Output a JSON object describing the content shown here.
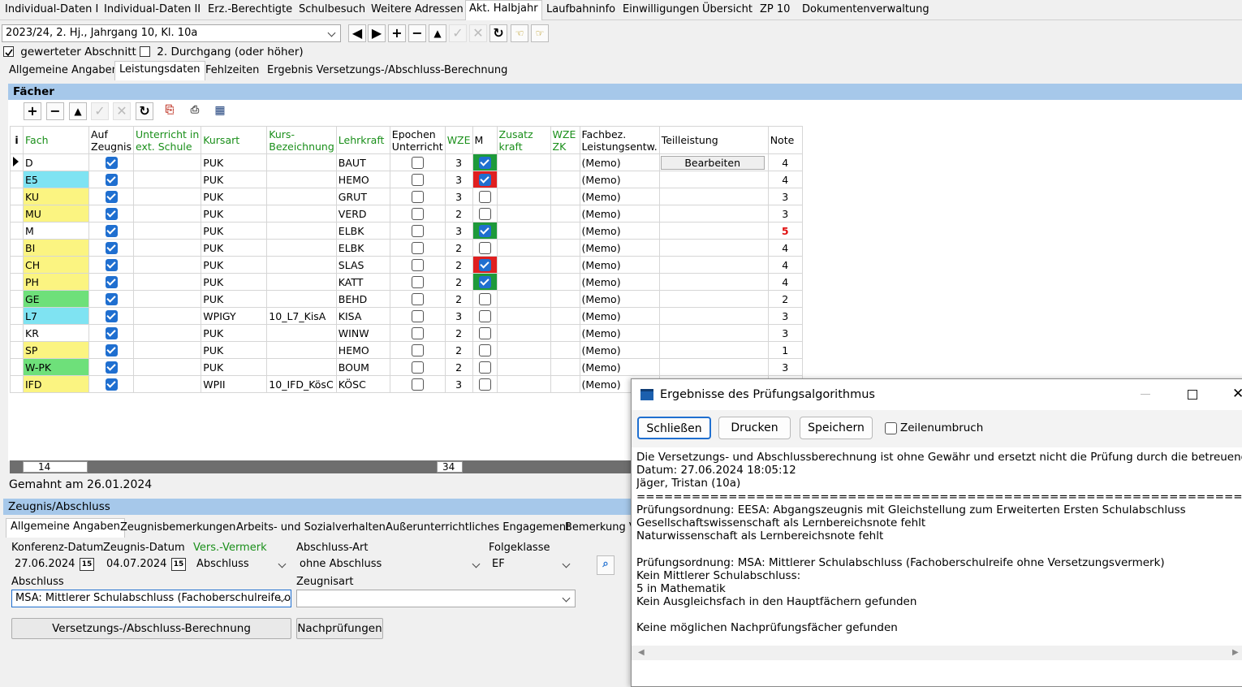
{
  "topnav": {
    "tabs": [
      {
        "label": "Individual-Daten I"
      },
      {
        "label": "Individual-Daten II"
      },
      {
        "label": "Erz.-Berechtigte"
      },
      {
        "label": "Schulbesuch"
      },
      {
        "label": "Weitere Adressen"
      },
      {
        "label": "Akt. Halbjahr"
      },
      {
        "label": "Laufbahninfo"
      },
      {
        "label": "Einwilligungen"
      },
      {
        "label": "Übersicht"
      },
      {
        "label": "ZP 10"
      },
      {
        "label": "Dokumentenverwaltung"
      }
    ],
    "active_tab": "Akt. Halbjahr"
  },
  "period": {
    "selected": "2023/24, 2. Hj., Jahrgang 10, Kl. 10a"
  },
  "options": {
    "gewerteter_label": "gewerteter Abschnitt",
    "gewerteter_checked": true,
    "durchgang_label": "2. Durchgang (oder höher)",
    "durchgang_checked": false
  },
  "subtabs": [
    {
      "label": "Allgemeine Angaben"
    },
    {
      "label": "Leistungsdaten"
    },
    {
      "label": "Fehlzeiten"
    },
    {
      "label": "Ergebnis Versetzungs-/Abschluss-Berechnung"
    }
  ],
  "faecher": {
    "title": "Fächer",
    "columns": {
      "info": "i",
      "fach": "Fach",
      "auf_zeugnis": [
        "Auf",
        "Zeugnis"
      ],
      "ext": [
        "Unterricht in",
        "ext. Schule"
      ],
      "kursart": "Kursart",
      "kursbez": [
        "Kurs-",
        "Bezeichnung"
      ],
      "lehrkraft": "Lehrkraft",
      "epochen": [
        "Epochen",
        "Unterricht"
      ],
      "wze": "WZE",
      "m": "M",
      "zusatz": [
        "Zusatz",
        "kraft"
      ],
      "wzezk": [
        "WZE",
        "ZK"
      ],
      "fachbez": [
        "Fachbez.",
        "Leistungsentw."
      ],
      "teilleistung": "Teilleistung",
      "note": "Note"
    },
    "bearbeiten_label": "Bearbeiten",
    "rows": [
      {
        "fach": "D",
        "color": "#ffffff",
        "kursart": "PUK",
        "kursbez": "",
        "lehrkraft": "BAUT",
        "wze": "3",
        "m": "green",
        "fachbez": "(Memo)",
        "note": "4",
        "note_red": false,
        "current": true
      },
      {
        "fach": "E5",
        "color": "#7fe3f2",
        "kursart": "PUK",
        "kursbez": "",
        "lehrkraft": "HEMO",
        "wze": "3",
        "m": "red",
        "fachbez": "(Memo)",
        "note": "4",
        "note_red": false
      },
      {
        "fach": "KU",
        "color": "#fbf481",
        "kursart": "PUK",
        "kursbez": "",
        "lehrkraft": "GRUT",
        "wze": "3",
        "m": "none",
        "fachbez": "(Memo)",
        "note": "3",
        "note_red": false
      },
      {
        "fach": "MU",
        "color": "#fbf481",
        "kursart": "PUK",
        "kursbez": "",
        "lehrkraft": "VERD",
        "wze": "2",
        "m": "none",
        "fachbez": "(Memo)",
        "note": "3",
        "note_red": false
      },
      {
        "fach": "M",
        "color": "#ffffff",
        "kursart": "PUK",
        "kursbez": "",
        "lehrkraft": "ELBK",
        "wze": "3",
        "m": "green",
        "fachbez": "(Memo)",
        "note": "5",
        "note_red": true
      },
      {
        "fach": "BI",
        "color": "#fbf481",
        "kursart": "PUK",
        "kursbez": "",
        "lehrkraft": "ELBK",
        "wze": "2",
        "m": "none",
        "fachbez": "(Memo)",
        "note": "4",
        "note_red": false
      },
      {
        "fach": "CH",
        "color": "#fbf481",
        "kursart": "PUK",
        "kursbez": "",
        "lehrkraft": "SLAS",
        "wze": "2",
        "m": "red",
        "fachbez": "(Memo)",
        "note": "4",
        "note_red": false
      },
      {
        "fach": "PH",
        "color": "#fbf481",
        "kursart": "PUK",
        "kursbez": "",
        "lehrkraft": "KATT",
        "wze": "2",
        "m": "green",
        "fachbez": "(Memo)",
        "note": "4",
        "note_red": false
      },
      {
        "fach": "GE",
        "color": "#6ee07a",
        "kursart": "PUK",
        "kursbez": "",
        "lehrkraft": "BEHD",
        "wze": "2",
        "m": "none",
        "fachbez": "(Memo)",
        "note": "2",
        "note_red": false
      },
      {
        "fach": "L7",
        "color": "#7fe3f2",
        "kursart": "WPIGY",
        "kursbez": "10_L7_KisA",
        "lehrkraft": "KISA",
        "wze": "3",
        "m": "none",
        "fachbez": "(Memo)",
        "note": "3",
        "note_red": false
      },
      {
        "fach": "KR",
        "color": "#ffffff",
        "kursart": "PUK",
        "kursbez": "",
        "lehrkraft": "WINW",
        "wze": "2",
        "m": "none",
        "fachbez": "(Memo)",
        "note": "3",
        "note_red": false
      },
      {
        "fach": "SP",
        "color": "#fbf481",
        "kursart": "PUK",
        "kursbez": "",
        "lehrkraft": "HEMO",
        "wze": "2",
        "m": "none",
        "fachbez": "(Memo)",
        "note": "1",
        "note_red": false
      },
      {
        "fach": "W-PK",
        "color": "#6ee07a",
        "kursart": "PUK",
        "kursbez": "",
        "lehrkraft": "BOUM",
        "wze": "2",
        "m": "none",
        "fachbez": "(Memo)",
        "note": "3",
        "note_red": false
      },
      {
        "fach": "IFD",
        "color": "#fbf481",
        "kursart": "WPII",
        "kursbez": "10_IFD_KösC",
        "lehrkraft": "KÖSC",
        "wze": "3",
        "m": "none",
        "fachbez": "(Memo)",
        "note": "",
        "note_red": false
      }
    ],
    "footer_count": "14",
    "footer_sum": "34"
  },
  "gemahnt": "Gemahnt am 26.01.2024",
  "zeugnis": {
    "title": "Zeugnis/Abschluss",
    "tabs": [
      {
        "label": "Allgemeine Angaben"
      },
      {
        "label": "Zeugnisbemerkungen"
      },
      {
        "label": "Arbeits- und Sozialverhalten"
      },
      {
        "label": "Außerunterrichtliches Engagement"
      },
      {
        "label": "Bemerkung Ve"
      }
    ],
    "konferenz_label": "Konferenz-Datum",
    "konferenz_value": "27.06.2024",
    "zeugnisdatum_label": "Zeugnis-Datum",
    "zeugnisdatum_value": "04.07.2024",
    "vers_label": "Vers.-Vermerk",
    "vers_value": "Abschluss",
    "abschlussart_label": "Abschluss-Art",
    "abschlussart_value": "ohne Abschluss",
    "folgeklasse_label": "Folgeklasse",
    "folgeklasse_value": "EF",
    "abschluss_label": "Abschluss",
    "abschluss_value": "MSA: Mittlerer Schulabschluss (Fachoberschulreife oh",
    "zeugnisart_label": "Zeugnisart",
    "zeugnisart_value": "",
    "berechnung_button": "Versetzungs-/Abschluss-Berechnung",
    "nachpruefungen_button": "Nachprüfungen",
    "cal_glyph": "15"
  },
  "dialog": {
    "title": "Ergebnisse des Prüfungsalgorithmus",
    "buttons": {
      "close": "Schließen",
      "print": "Drucken",
      "save": "Speichern"
    },
    "wrap_label": "Zeilenumbruch",
    "lines": [
      "Die Versetzungs- und Abschlussberechnung ist ohne Gewähr und ersetzt nicht die Prüfung durch die betreuende Lehrkraft.",
      "Datum: 27.06.2024 18:05:12",
      "Jäger, Tristan (10a)",
      "========================================================================================",
      "Prüfungsordnung: EESA: Abgangszeugnis mit Gleichstellung zum Erweiterten Ersten Schulabschluss",
      "Gesellschaftswissenschaft als Lernbereichsnote fehlt",
      "Naturwissenschaft als Lernbereichsnote fehlt",
      "",
      "Prüfungsordnung: MSA: Mittlerer Schulabschluss (Fachoberschulreife ohne Versetzungsvermerk)",
      "Kein Mittlerer Schulabschluss:",
      "5 in Mathematik",
      "Kein Ausgleichsfach in den Hauptfächern gefunden",
      "",
      "Keine möglichen Nachprüfungsfächer gefunden"
    ]
  }
}
